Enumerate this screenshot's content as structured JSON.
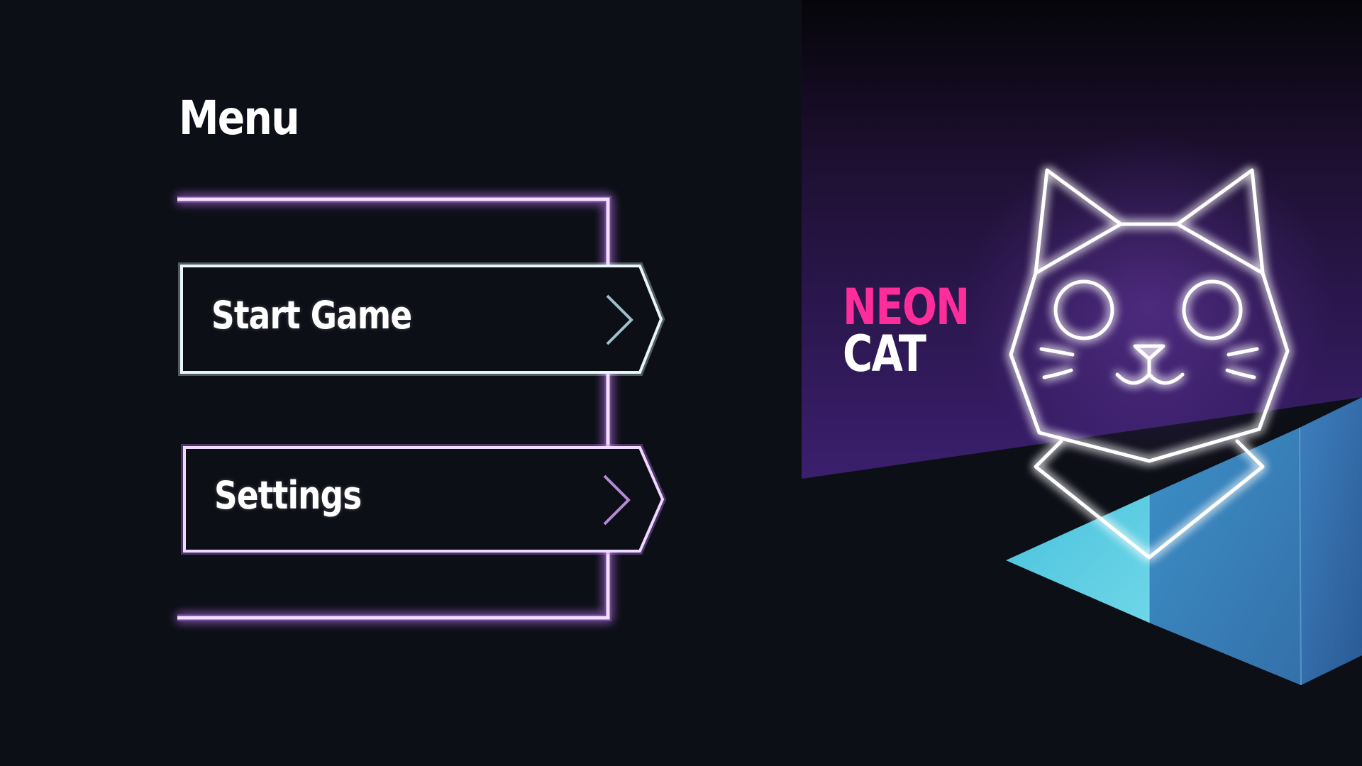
{
  "menu": {
    "title": "Menu",
    "items": [
      {
        "label": "Start Game",
        "icon": "chevron-right-icon",
        "accent": "#cfe9ef"
      },
      {
        "label": "Settings",
        "icon": "chevron-right-icon",
        "accent": "#e6c6ff"
      }
    ]
  },
  "brand": {
    "line1": "NEON",
    "line2": "CAT"
  },
  "colors": {
    "background": "#0d0f17",
    "frame_glow": "#c77dff",
    "brand_pink": "#ff2d9b",
    "panel_purple": "#3a1f6b",
    "cube_cyan": "#5ccfe0",
    "cube_blue": "#3a78b3"
  },
  "art": {
    "mascot": "neon-cat-head-icon"
  }
}
